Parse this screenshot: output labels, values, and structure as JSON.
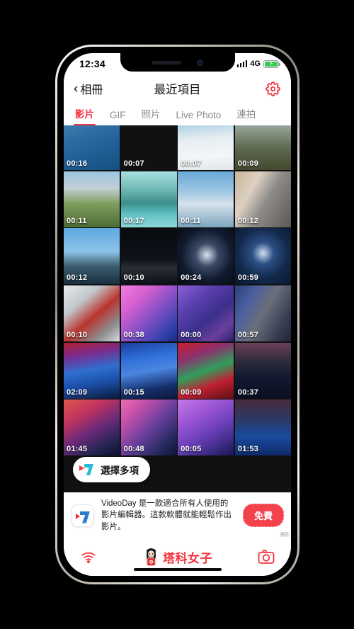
{
  "status_bar": {
    "time": "12:34",
    "network": "4G",
    "signal_icon": "cellular-signal-icon",
    "battery_icon": "battery-charging-icon"
  },
  "nav_bar": {
    "back_label": "相冊",
    "back_icon": "chevron-left-icon",
    "title": "最近項目",
    "settings_icon": "gear-icon"
  },
  "tabs": [
    {
      "label": "影片",
      "active": true
    },
    {
      "label": "GIF",
      "active": false
    },
    {
      "label": "照片",
      "active": false
    },
    {
      "label": "Live Photo",
      "active": false
    },
    {
      "label": "連拍",
      "active": false
    }
  ],
  "grid": {
    "columns": 4,
    "items": [
      {
        "duration": "00:16",
        "scene": "blue-fabric-jeans"
      },
      {
        "duration": "00:07",
        "scene": "gothic-town-hall"
      },
      {
        "duration": "00:07",
        "scene": "snow-slope"
      },
      {
        "duration": "00:09",
        "scene": "hillside-village"
      },
      {
        "duration": "00:11",
        "scene": "riverbank-crowd"
      },
      {
        "duration": "00:17",
        "scene": "green-lake-mountains"
      },
      {
        "duration": "00:11",
        "scene": "lake-snow-mountains"
      },
      {
        "duration": "00:12",
        "scene": "luggage-indoor"
      },
      {
        "duration": "00:12",
        "scene": "bay-bridge-dusk"
      },
      {
        "duration": "00:10",
        "scene": "night-harbor-lights"
      },
      {
        "duration": "00:24",
        "scene": "stage-lights-white"
      },
      {
        "duration": "00:59",
        "scene": "stage-blue-lights"
      },
      {
        "duration": "00:10",
        "scene": "metal-structure-red"
      },
      {
        "duration": "00:38",
        "scene": "concert-pink-stage"
      },
      {
        "duration": "00:00",
        "scene": "concert-purple-stage"
      },
      {
        "duration": "00:57",
        "scene": "concert-backstage-2019"
      },
      {
        "duration": "02:09",
        "scene": "concert-red-blue-stage"
      },
      {
        "duration": "00:15",
        "scene": "concert-blue-scaffold"
      },
      {
        "duration": "00:09",
        "scene": "concert-red-green-stage"
      },
      {
        "duration": "00:37",
        "scene": "concert-singer-dark"
      },
      {
        "duration": "01:45",
        "scene": "concert-2019-red-screen"
      },
      {
        "duration": "00:48",
        "scene": "concert-singer-pink"
      },
      {
        "duration": "00:05",
        "scene": "concert-purple-curtain"
      },
      {
        "duration": "01:53",
        "scene": "concert-singer-white"
      }
    ]
  },
  "select_multi_button": {
    "label": "選擇多項",
    "icon": "videoday-logo-icon"
  },
  "ad": {
    "icon": "videoday-app-icon",
    "text": "VideoDay 是一款適合所有人使用的影片編輯器。這款軟體就能輕鬆作出影片。",
    "cta_label": "免費",
    "tag": "AD"
  },
  "toolbar": {
    "left_icon": "airdrop-wifi-icon",
    "right_icon": "camera-icon",
    "watermark_text": "塔科女子",
    "watermark_avatar": "girl-avatar-icon",
    "home_indicator": "home-indicator"
  },
  "colors": {
    "accent_red": "#f5333f",
    "ad_cta_red": "#f4424c",
    "tab_inactive": "#8b8b8f",
    "battery_green": "#37c85a"
  }
}
